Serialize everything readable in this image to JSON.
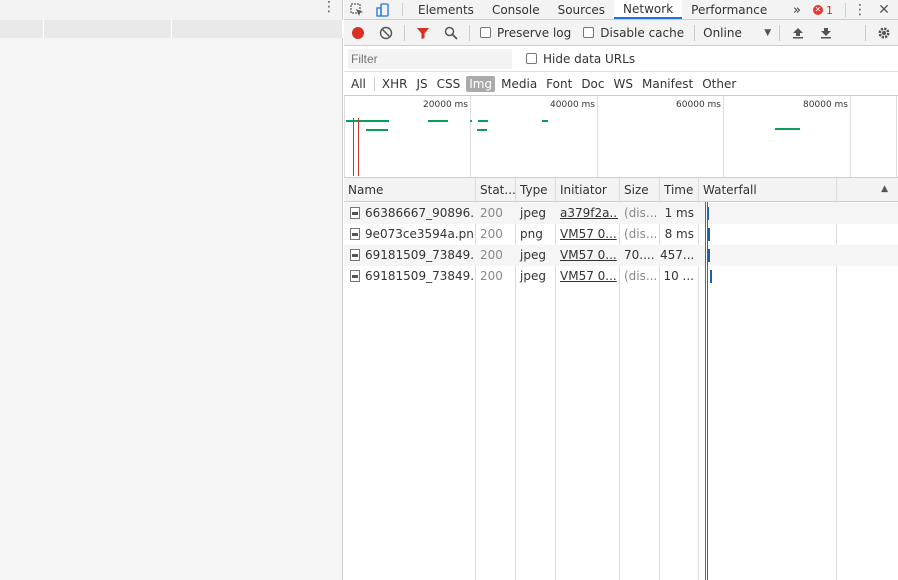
{
  "devtools": {
    "tabs": [
      {
        "label": "Elements",
        "active": false
      },
      {
        "label": "Console",
        "active": false
      },
      {
        "label": "Sources",
        "active": false
      },
      {
        "label": "Network",
        "active": true
      },
      {
        "label": "Performance",
        "active": false
      }
    ],
    "more_tabs_icon": "»",
    "error_count": "1",
    "toolbar": {
      "preserve_log_label": "Preserve log",
      "disable_cache_label": "Disable cache",
      "throttle_value": "Online"
    },
    "filter": {
      "placeholder": "Filter",
      "hide_data_urls_label": "Hide data URLs"
    },
    "types": [
      "All",
      "XHR",
      "JS",
      "CSS",
      "Img",
      "Media",
      "Font",
      "Doc",
      "WS",
      "Manifest",
      "Other"
    ],
    "active_type": "Img",
    "overview": {
      "ticks": [
        "20000 ms",
        "40000 ms",
        "60000 ms",
        "80000 ms"
      ]
    },
    "columns": [
      "Name",
      "Stat...",
      "Type",
      "Initiator",
      "Size",
      "Time",
      "Waterfall"
    ],
    "rows": [
      {
        "name": "66386667_90896...",
        "status": "200",
        "type": "jpeg",
        "initiator": "a379f2a...",
        "size": "(dis...",
        "time": "1 ms"
      },
      {
        "name": "9e073ce3594a.png",
        "status": "200",
        "type": "png",
        "initiator": "VM57 0...",
        "size": "(dis...",
        "time": "8 ms"
      },
      {
        "name": "69181509_73849...",
        "status": "200",
        "type": "jpeg",
        "initiator": "VM57 0...",
        "size": "70....",
        "time": "457..."
      },
      {
        "name": "69181509_73849...",
        "status": "200",
        "type": "jpeg",
        "initiator": "VM57 0...",
        "size": "(dis...",
        "time": "10 ..."
      }
    ]
  },
  "colors": {
    "active_tab_accent": "#1a73e8",
    "record": "#d93025",
    "filter_icon": "#d93025",
    "overview_bars": "#0a9e5a",
    "waterfall_bar": "#1a5fb4"
  },
  "icons": [
    "inspect-icon",
    "device-toolbar-icon",
    "kebab-icon",
    "close-icon",
    "record-icon",
    "clear-icon",
    "filter-icon",
    "search-icon",
    "upload-icon",
    "download-icon",
    "gear-icon",
    "sort-asc-icon"
  ]
}
